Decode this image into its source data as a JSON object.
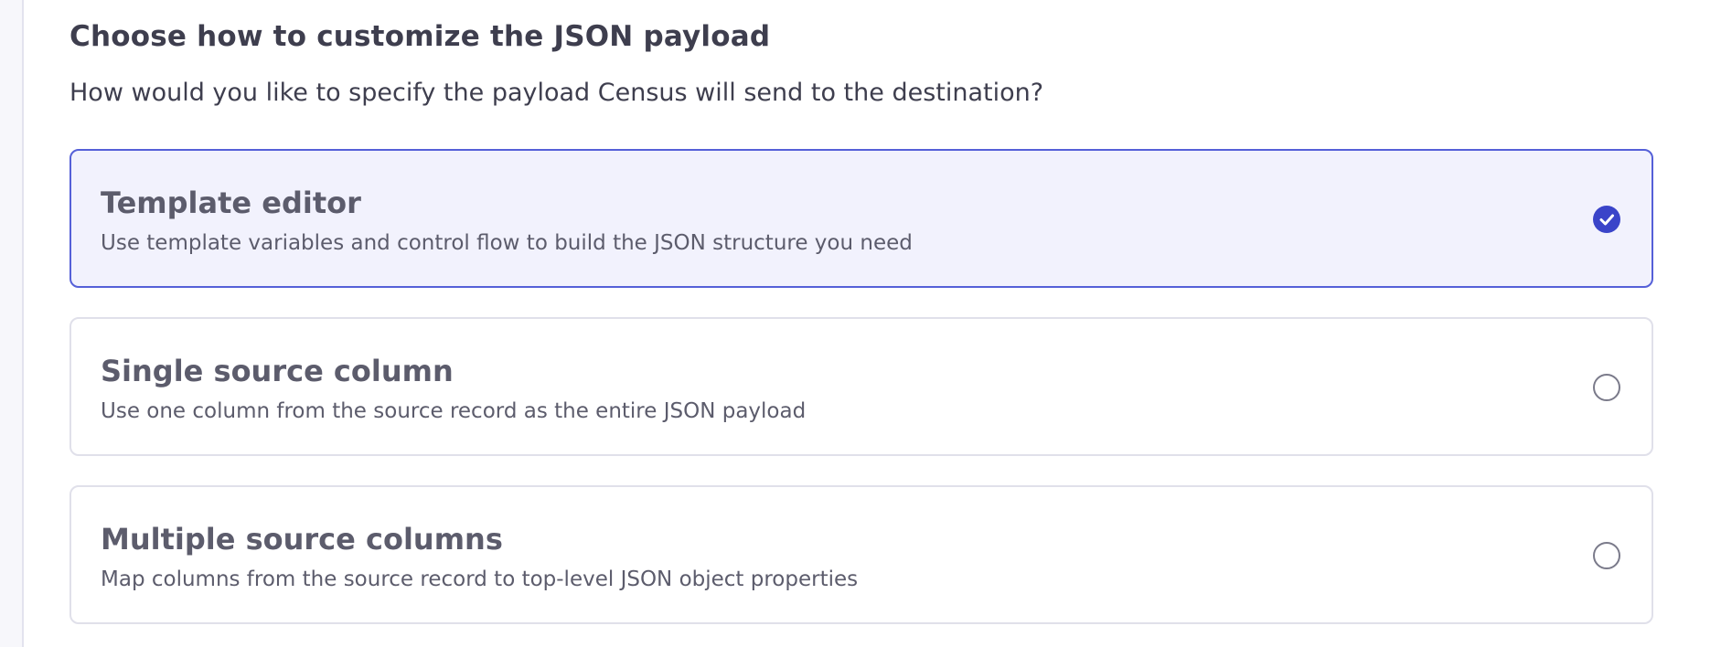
{
  "section": {
    "title": "Choose how to customize the JSON payload",
    "description": "How would you like to specify the payload Census will send to the destination?"
  },
  "options": [
    {
      "title": "Template editor",
      "description": "Use template variables and control flow to build the JSON structure you need",
      "selected": true,
      "icon": "check-circle-icon"
    },
    {
      "title": "Single source column",
      "description": "Use one column from the source record as the entire JSON payload",
      "selected": false,
      "icon": "radio-empty-icon"
    },
    {
      "title": "Multiple source columns",
      "description": "Map columns from the source record to top-level JSON object properties",
      "selected": false,
      "icon": "radio-empty-icon"
    }
  ],
  "colors": {
    "accent": "#3a44c9",
    "selected_border": "#5560d8",
    "selected_bg": "#f2f2fd",
    "text": "#3e3e4e",
    "muted_text": "#5c5c6c"
  }
}
